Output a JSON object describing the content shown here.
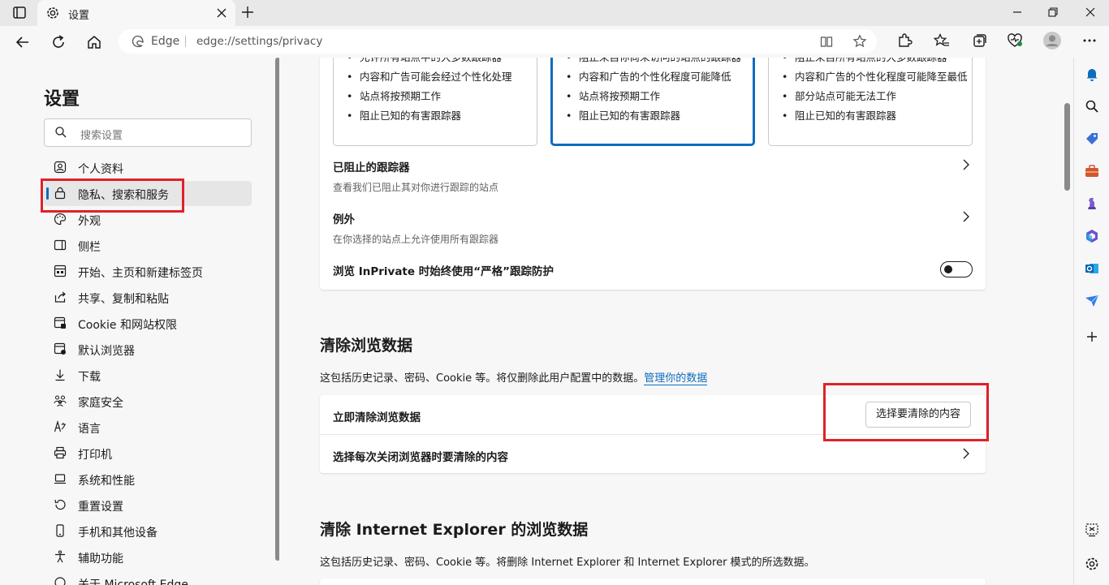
{
  "tab": {
    "title": "设置"
  },
  "address": {
    "edge_label": "Edge",
    "url": "edge://settings/privacy"
  },
  "settings_nav": {
    "title": "设置",
    "search_placeholder": "搜索设置",
    "items": [
      {
        "label": "个人资料",
        "icon": "profile-icon"
      },
      {
        "label": "隐私、搜索和服务",
        "icon": "lock-icon",
        "active": true
      },
      {
        "label": "外观",
        "icon": "palette-icon"
      },
      {
        "label": "侧栏",
        "icon": "sidebar-icon"
      },
      {
        "label": "开始、主页和新建标签页",
        "icon": "home-grid-icon"
      },
      {
        "label": "共享、复制和粘贴",
        "icon": "share-icon"
      },
      {
        "label": "Cookie 和网站权限",
        "icon": "site-permissions-icon"
      },
      {
        "label": "默认浏览器",
        "icon": "browser-icon"
      },
      {
        "label": "下载",
        "icon": "download-icon"
      },
      {
        "label": "家庭安全",
        "icon": "family-icon"
      },
      {
        "label": "语言",
        "icon": "language-icon"
      },
      {
        "label": "打印机",
        "icon": "printer-icon"
      },
      {
        "label": "系统和性能",
        "icon": "laptop-icon"
      },
      {
        "label": "重置设置",
        "icon": "reset-icon"
      },
      {
        "label": "手机和其他设备",
        "icon": "phone-icon"
      },
      {
        "label": "辅助功能",
        "icon": "accessibility-icon"
      },
      {
        "label": "关于 Microsoft Edge",
        "icon": "edge-icon"
      }
    ]
  },
  "tracking": {
    "basic": [
      "允许所有站点中的大多数跟踪器",
      "内容和广告可能会经过个性化处理",
      "站点将按预期工作",
      "阻止已知的有害跟踪器"
    ],
    "balanced": [
      "阻止来自你尚未访问的站点的跟踪器",
      "内容和广告的个性化程度可能降低",
      "站点将按预期工作",
      "阻止已知的有害跟踪器"
    ],
    "strict": [
      "阻止来自所有站点的大多数跟踪器",
      "内容和广告的个性化程度可能降至最低",
      "部分站点可能无法工作",
      "阻止已知的有害跟踪器"
    ],
    "blocked_title": "已阻止的跟踪器",
    "blocked_sub": "查看我们已阻止其对你进行跟踪的站点",
    "exceptions_title": "例外",
    "exceptions_sub": "在你选择的站点上允许使用所有跟踪器",
    "inprivate_label": "浏览 InPrivate 时始终使用“严格”跟踪防护",
    "inprivate_on": false
  },
  "clear_data": {
    "title": "清除浏览数据",
    "desc": "这包括历史记录、密码、Cookie 等。将仅删除此用户配置中的数据。",
    "link": "管理你的数据",
    "now_label": "立即清除浏览数据",
    "choose_button": "选择要清除的内容",
    "on_close_label": "选择每次关闭浏览器时要清除的内容"
  },
  "clear_ie": {
    "title": "清除 Internet Explorer 的浏览数据",
    "desc": "这包括历史记录、密码、Cookie 等。将删除 Internet Explorer 和 Internet Explorer 模式的所选数据。"
  },
  "colors": {
    "accent": "#0f6cbd",
    "highlight": "#e0202a"
  }
}
